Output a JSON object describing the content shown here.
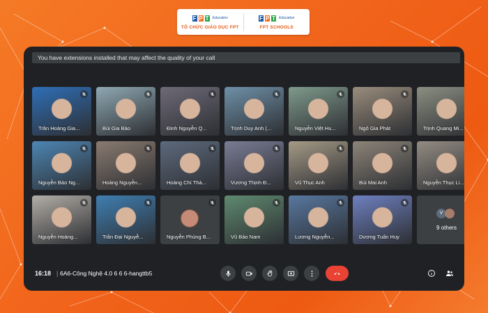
{
  "branding": {
    "left_logo_text": "TỔ CHỨC GIÁO DỤC FPT",
    "right_logo_text": "FPT SCHOOLS",
    "fpt_letters": [
      "F",
      "P",
      "T"
    ],
    "edu_label": "Education"
  },
  "meet": {
    "warning": "You have extensions installed that may affect the quality of your call",
    "time": "16:18",
    "separator": "|",
    "meeting_name": "6A6-Công Nghệ 4.0 6 6 6-hangttb5",
    "colors": {
      "background": "#202124",
      "end_call": "#ea4335",
      "control": "#3c4043"
    }
  },
  "participants": [
    {
      "name": "Trần Hoàng Gia...",
      "muted": true,
      "tone": "#2f6fb7"
    },
    {
      "name": "Bùi Gia Bảo",
      "muted": true,
      "tone": "#8fa9b3"
    },
    {
      "name": "Đinh Nguyễn Q...",
      "muted": true,
      "tone": "#6e6a78"
    },
    {
      "name": "Trịnh Duy Anh (...",
      "muted": true,
      "tone": "#6f90a8"
    },
    {
      "name": "Nguyễn Việt Hu...",
      "muted": true,
      "tone": "#7f9a8c"
    },
    {
      "name": "Ngô Gia Phát",
      "muted": true,
      "tone": "#9a8d7c"
    },
    {
      "name": "Trịnh Quang Mi...",
      "muted": true,
      "tone": "#8b8f82"
    },
    {
      "name": "Nguyễn Bảo Ng...",
      "muted": true,
      "tone": "#4d86b4"
    },
    {
      "name": "Hoàng Nguyễn...",
      "muted": true,
      "tone": "#8a7b70"
    },
    {
      "name": "Hoàng Chí Thà...",
      "muted": true,
      "tone": "#5d6a7d"
    },
    {
      "name": "Vương Thịnh Đ...",
      "muted": true,
      "tone": "#7a7c95"
    },
    {
      "name": "Vũ Thục Anh",
      "muted": true,
      "tone": "#a59a86"
    },
    {
      "name": "Bùi Mai Anh",
      "muted": true,
      "tone": "#8c8478"
    },
    {
      "name": "Nguyễn Thục Li...",
      "muted": true,
      "tone": "#938c82"
    },
    {
      "name": "Nguyễn Hoàng...",
      "muted": true,
      "tone": "#b3aea7"
    },
    {
      "name": "Trần Đại Nguyễ...",
      "muted": true,
      "tone": "#3f7fb2"
    },
    {
      "name": "Nguyễn Phùng B...",
      "muted": true,
      "tone": "#3c4043",
      "avatar": true
    },
    {
      "name": "Vũ Bảo Nam",
      "muted": true,
      "tone": "#5f8a6f"
    },
    {
      "name": "Lương Nguyễn...",
      "muted": true,
      "tone": "#5878a0"
    },
    {
      "name": "Dương Tuấn Huy",
      "muted": true,
      "tone": "#6e80c0"
    },
    {
      "name": "9 others",
      "muted": false,
      "tone": "#3c4043",
      "others": true,
      "initial": "V"
    }
  ],
  "controls": [
    {
      "name": "mic-icon"
    },
    {
      "name": "camera-icon"
    },
    {
      "name": "raise-hand-icon"
    },
    {
      "name": "present-icon"
    },
    {
      "name": "more-options-icon"
    },
    {
      "name": "end-call-icon"
    }
  ],
  "right_controls": [
    {
      "name": "info-icon"
    },
    {
      "name": "people-icon"
    }
  ]
}
